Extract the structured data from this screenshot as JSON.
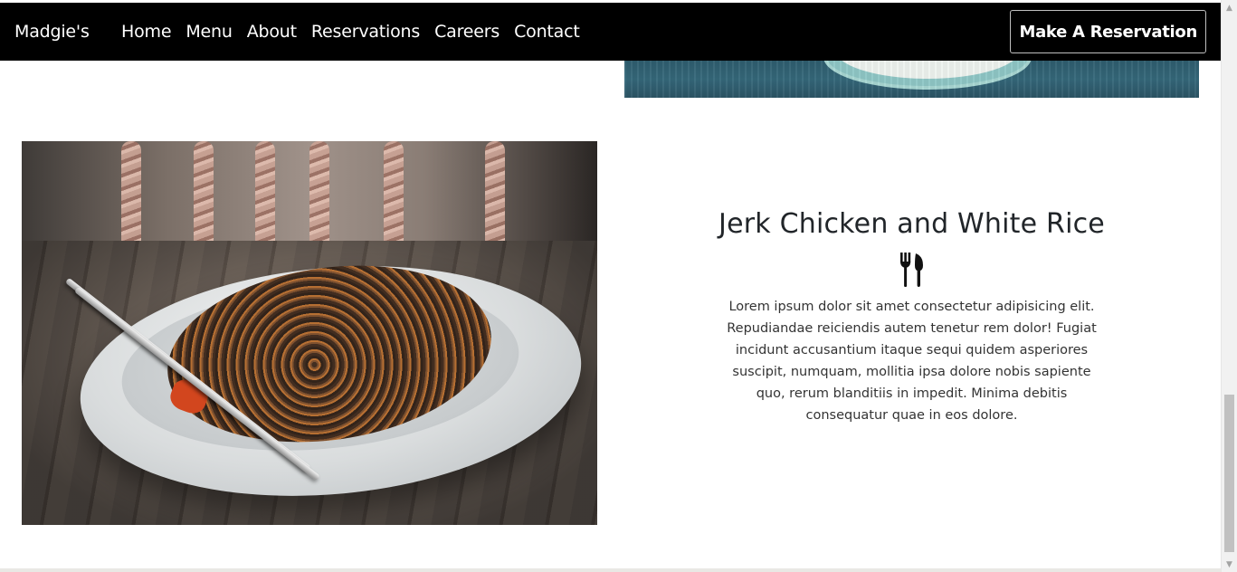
{
  "navbar": {
    "brand": "Madgie's",
    "links": [
      "Home",
      "Menu",
      "About",
      "Reservations",
      "Careers",
      "Contact"
    ],
    "cta": "Make A Reservation"
  },
  "dish": {
    "title": "Jerk Chicken and White Rice",
    "icon": "utensils-icon",
    "description": "Lorem ipsum dolor sit amet consectetur adipisicing elit. Repudiandae reiciendis autem tenetur rem dolor! Fugiat incidunt accusantium itaque sequi quidem asperiores suscipit, numquam, mollitia ipsa dolore nobis sapiente quo, rerum blanditiis in impedit. Minima debitis consequatur quae in eos dolore."
  },
  "colors": {
    "navbar_bg": "#000000",
    "navbar_text": "#ffffff",
    "page_bg": "#ffffff",
    "text": "#212529"
  },
  "scrollbar": {
    "position_fraction": 0.83
  }
}
